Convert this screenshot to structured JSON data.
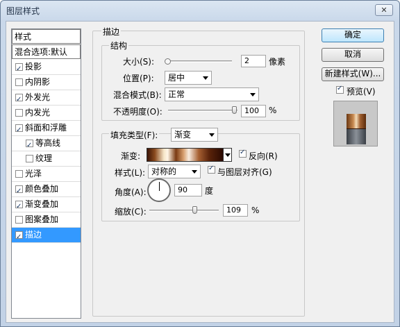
{
  "window": {
    "title": "图层样式",
    "close_glyph": "✕"
  },
  "styles_list": {
    "header": "样式",
    "blend_item": "混合选项:默认",
    "items": [
      {
        "label": "投影",
        "checked": true,
        "indent": false
      },
      {
        "label": "内阴影",
        "checked": false,
        "indent": false
      },
      {
        "label": "外发光",
        "checked": true,
        "indent": false
      },
      {
        "label": "内发光",
        "checked": false,
        "indent": false
      },
      {
        "label": "斜面和浮雕",
        "checked": true,
        "indent": false
      },
      {
        "label": "等高线",
        "checked": true,
        "indent": true
      },
      {
        "label": "纹理",
        "checked": false,
        "indent": true
      },
      {
        "label": "光泽",
        "checked": false,
        "indent": false
      },
      {
        "label": "颜色叠加",
        "checked": true,
        "indent": false
      },
      {
        "label": "渐变叠加",
        "checked": true,
        "indent": false
      },
      {
        "label": "图案叠加",
        "checked": false,
        "indent": false
      },
      {
        "label": "描边",
        "checked": true,
        "indent": false,
        "selected": true
      }
    ]
  },
  "stroke": {
    "group_title": "描边",
    "structure": {
      "title": "结构",
      "size_label": "大小(S):",
      "size_value": "2",
      "size_unit": "像素",
      "position_label": "位置(P):",
      "position_value": "居中",
      "blend_label": "混合模式(B):",
      "blend_value": "正常",
      "opacity_label": "不透明度(O):",
      "opacity_value": "100",
      "opacity_unit": "%"
    },
    "fill": {
      "fill_type_label": "填充类型(F):",
      "fill_type_value": "渐变",
      "gradient_label": "渐变:",
      "reverse_label": "反向(R)",
      "reverse_checked": true,
      "style_label": "样式(L):",
      "style_value": "对称的",
      "align_label": "与图层对齐(G)",
      "align_checked": true,
      "angle_label": "角度(A):",
      "angle_value": "90",
      "angle_unit": "度",
      "scale_label": "缩放(C):",
      "scale_value": "109",
      "scale_unit": "%"
    }
  },
  "buttons": {
    "ok": "确定",
    "cancel": "取消",
    "new_style": "新建样式(W)...",
    "preview_label": "预览(V)",
    "preview_checked": true
  },
  "colors": {
    "selection": "#3399ff",
    "default_button": "#bee6fd"
  }
}
